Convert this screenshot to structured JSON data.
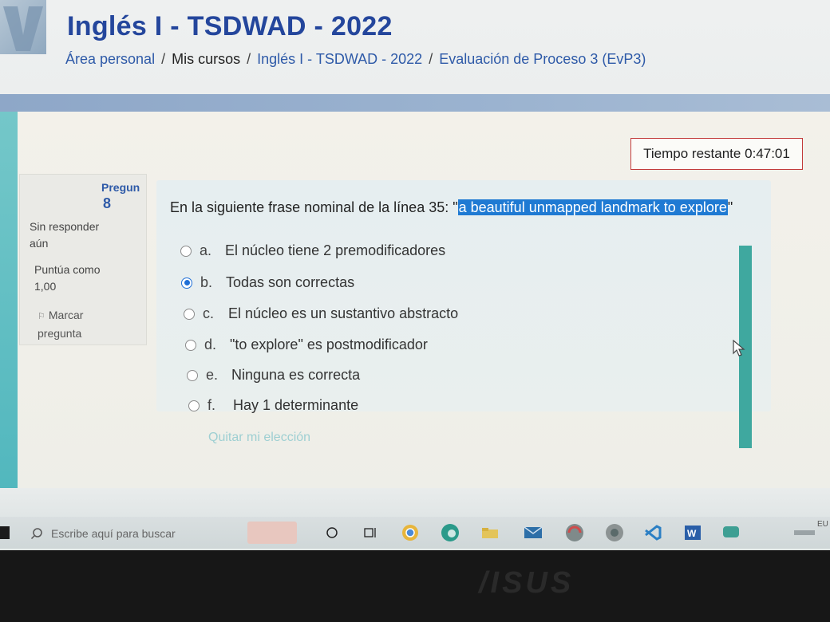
{
  "header": {
    "site_title": "Inglés I - TSDWAD - 2022",
    "breadcrumb": [
      {
        "label": "Área personal",
        "link": true
      },
      {
        "label": "Mis cursos",
        "link": false
      },
      {
        "label": "Inglés I - TSDWAD - 2022",
        "link": true
      },
      {
        "label": "Evaluación de Proceso 3 (EvP3)",
        "link": true
      }
    ],
    "separator": "/"
  },
  "timer": {
    "label": "Tiempo restante",
    "value": "0:47:01"
  },
  "question_info": {
    "label": "Pregun",
    "number": "8",
    "status_line1": "Sin responder",
    "status_line2": "aún",
    "grade_line1": "Puntúa como",
    "grade_line2": "1,00",
    "flag_line1": "Marcar",
    "flag_line2": "pregunta"
  },
  "question": {
    "prefix": "En la siguiente frase nominal de la línea 35: \"",
    "highlighted": "a beautiful unmapped landmark to explore",
    "suffix": "\""
  },
  "answers": [
    {
      "letter": "a.",
      "text": "El núcleo tiene 2 premodificadores",
      "selected": false
    },
    {
      "letter": "b.",
      "text": "Todas son correctas",
      "selected": true
    },
    {
      "letter": "c.",
      "text": "El núcleo es un sustantivo abstracto",
      "selected": false
    },
    {
      "letter": "d.",
      "text": "\"to explore\" es postmodificador",
      "selected": false
    },
    {
      "letter": "e.",
      "text": "Ninguna es correcta",
      "selected": false
    },
    {
      "letter": "f.",
      "text": "Hay 1 determinante",
      "selected": false
    }
  ],
  "clear_choice": "Quitar mi elección",
  "taskbar": {
    "search_placeholder": "Escribe aquí para buscar",
    "tray_text": "EU",
    "icons": [
      "cortana-icon",
      "task-view-icon",
      "chrome-icon",
      "edge-icon",
      "folder-icon",
      "mail-icon",
      "app-icon",
      "app-icon-2",
      "vscode-icon",
      "word-icon",
      "chat-icon"
    ]
  },
  "laptop": {
    "brand": "/ISUS"
  },
  "colors": {
    "title_blue": "#24469c",
    "link_blue": "#2e5aa8",
    "highlight": "#1f7ad3",
    "timer_border": "#c23b3b",
    "accent_teal": "#3fa89f"
  }
}
